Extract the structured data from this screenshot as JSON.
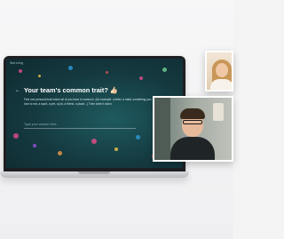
{
  "screen": {
    "app_label": "Warming",
    "prompt_arrow": "←",
    "prompt_title": "Your team's common trait? 👍🏻",
    "prompt_body": "Find one personal trait which all of you have in common. (for example: a letter, a habit, something you love to eat, a sport, a pet, a job, a friend, a place...) Then write it down.",
    "answer_placeholder": "Type your answer here..."
  },
  "video_call": {
    "participants": [
      "participant-woman",
      "participant-man"
    ]
  },
  "colors": {
    "screen_bg": "#14393f",
    "accent_teal": "#1e5a5f",
    "tile_border": "#ffffff"
  }
}
